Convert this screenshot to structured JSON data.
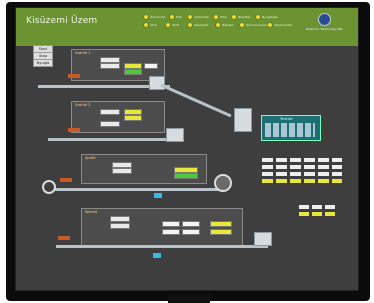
{
  "app": {
    "title": "Kisüzemi Üzem",
    "accent": "#6c9332",
    "background": "#3e3e3e",
    "logo_text": "Beltronic Technology Kft."
  },
  "status_indicators": [
    {
      "label": "Üzemmód",
      "color": "#f2dc2a"
    },
    {
      "label": "Kézi",
      "color": "#f2dc2a"
    },
    {
      "label": "Automata",
      "color": "#f2dc2a"
    },
    {
      "label": "Hiba",
      "color": "#f2dc2a"
    },
    {
      "label": "Riasztás",
      "color": "#f2dc2a"
    },
    {
      "label": "Nyugtázás",
      "color": "#f2dc2a"
    },
    {
      "label": "Stop",
      "color": "#f2dc2a"
    },
    {
      "label": "Start",
      "color": "#f2dc2a"
    },
    {
      "label": "Készenlét",
      "color": "#f2dc2a"
    },
    {
      "label": "Hálózat",
      "color": "#f2dc2a"
    },
    {
      "label": "Kommunikáció",
      "color": "#f2dc2a"
    },
    {
      "label": "Adatmentés",
      "color": "#f2dc2a"
    }
  ],
  "left_buttons": [
    {
      "label": "Start"
    },
    {
      "label": "Stop"
    },
    {
      "label": "Nyugta"
    }
  ],
  "lines": [
    {
      "name": "Vonal 1"
    },
    {
      "name": "Vonal 2"
    },
    {
      "name": "Vonal 3"
    },
    {
      "name": "Vonal 4"
    }
  ],
  "panels": [
    {
      "title": "Szárító 1"
    },
    {
      "title": "Szárító 2"
    },
    {
      "title": "Aprító"
    },
    {
      "title": "Keverő"
    }
  ],
  "right_table": {
    "title": "Termék"
  },
  "icons": [
    "logo-icon",
    "led-icon",
    "machine-icon",
    "conveyor-icon",
    "drum-icon",
    "pump-icon"
  ]
}
